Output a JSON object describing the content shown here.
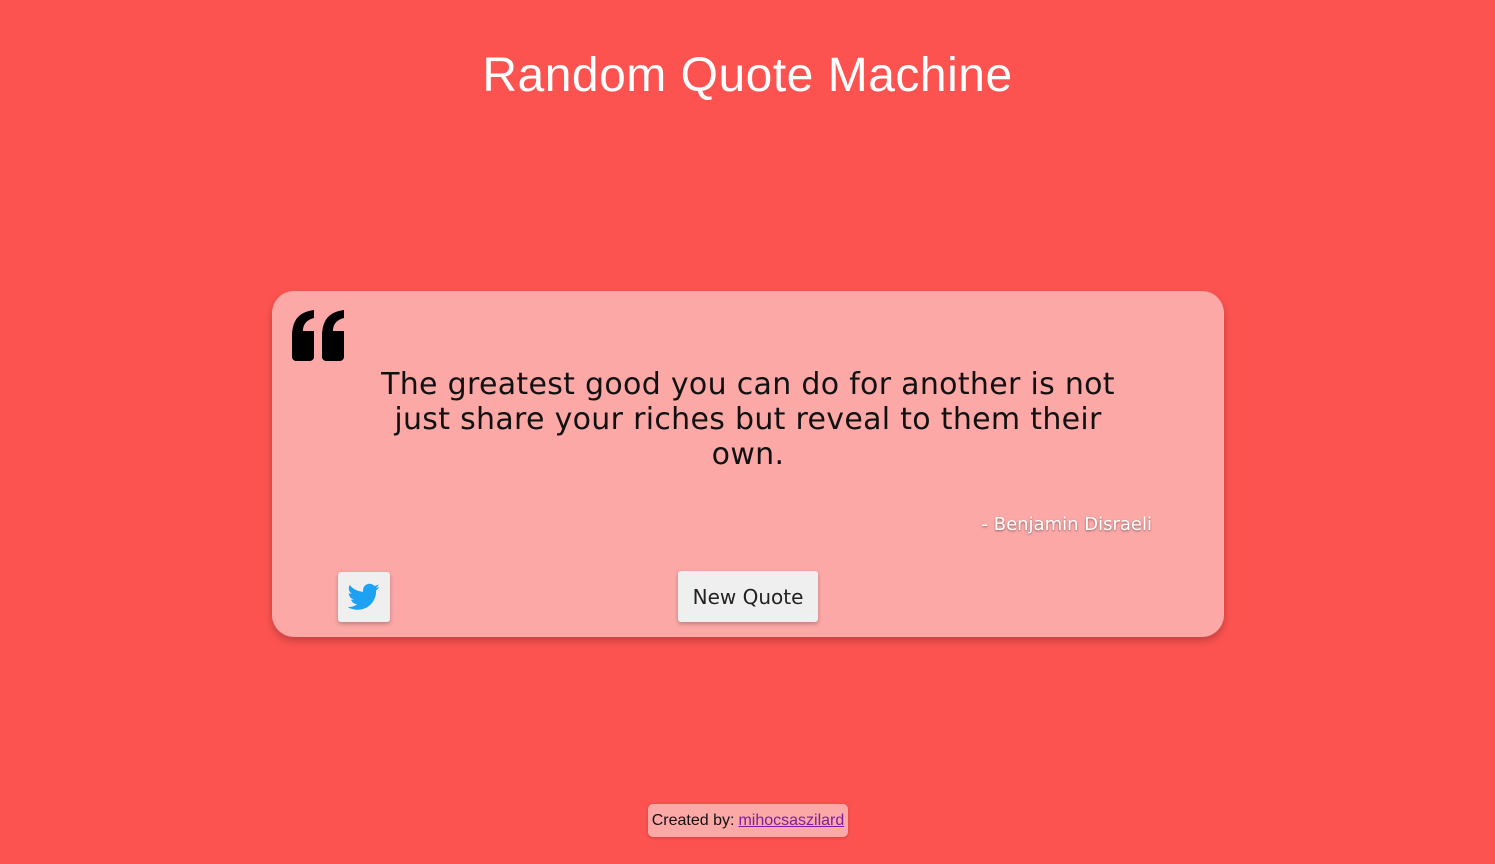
{
  "header": {
    "title": "Random Quote Machine"
  },
  "quote": {
    "icon": "quote-left-icon",
    "text": "The greatest good you can do for another is not just share your riches but reveal to them their own.",
    "author": "- Benjamin Disraeli"
  },
  "actions": {
    "tweet_icon": "twitter-icon",
    "new_quote_label": "New Quote"
  },
  "footer": {
    "prefix": "Created by:",
    "author_link": "mihocsaszilard"
  },
  "colors": {
    "background": "#fc5350",
    "card": "#fca8a7",
    "twitter": "#1da1f2",
    "link": "#7b1fa2"
  }
}
